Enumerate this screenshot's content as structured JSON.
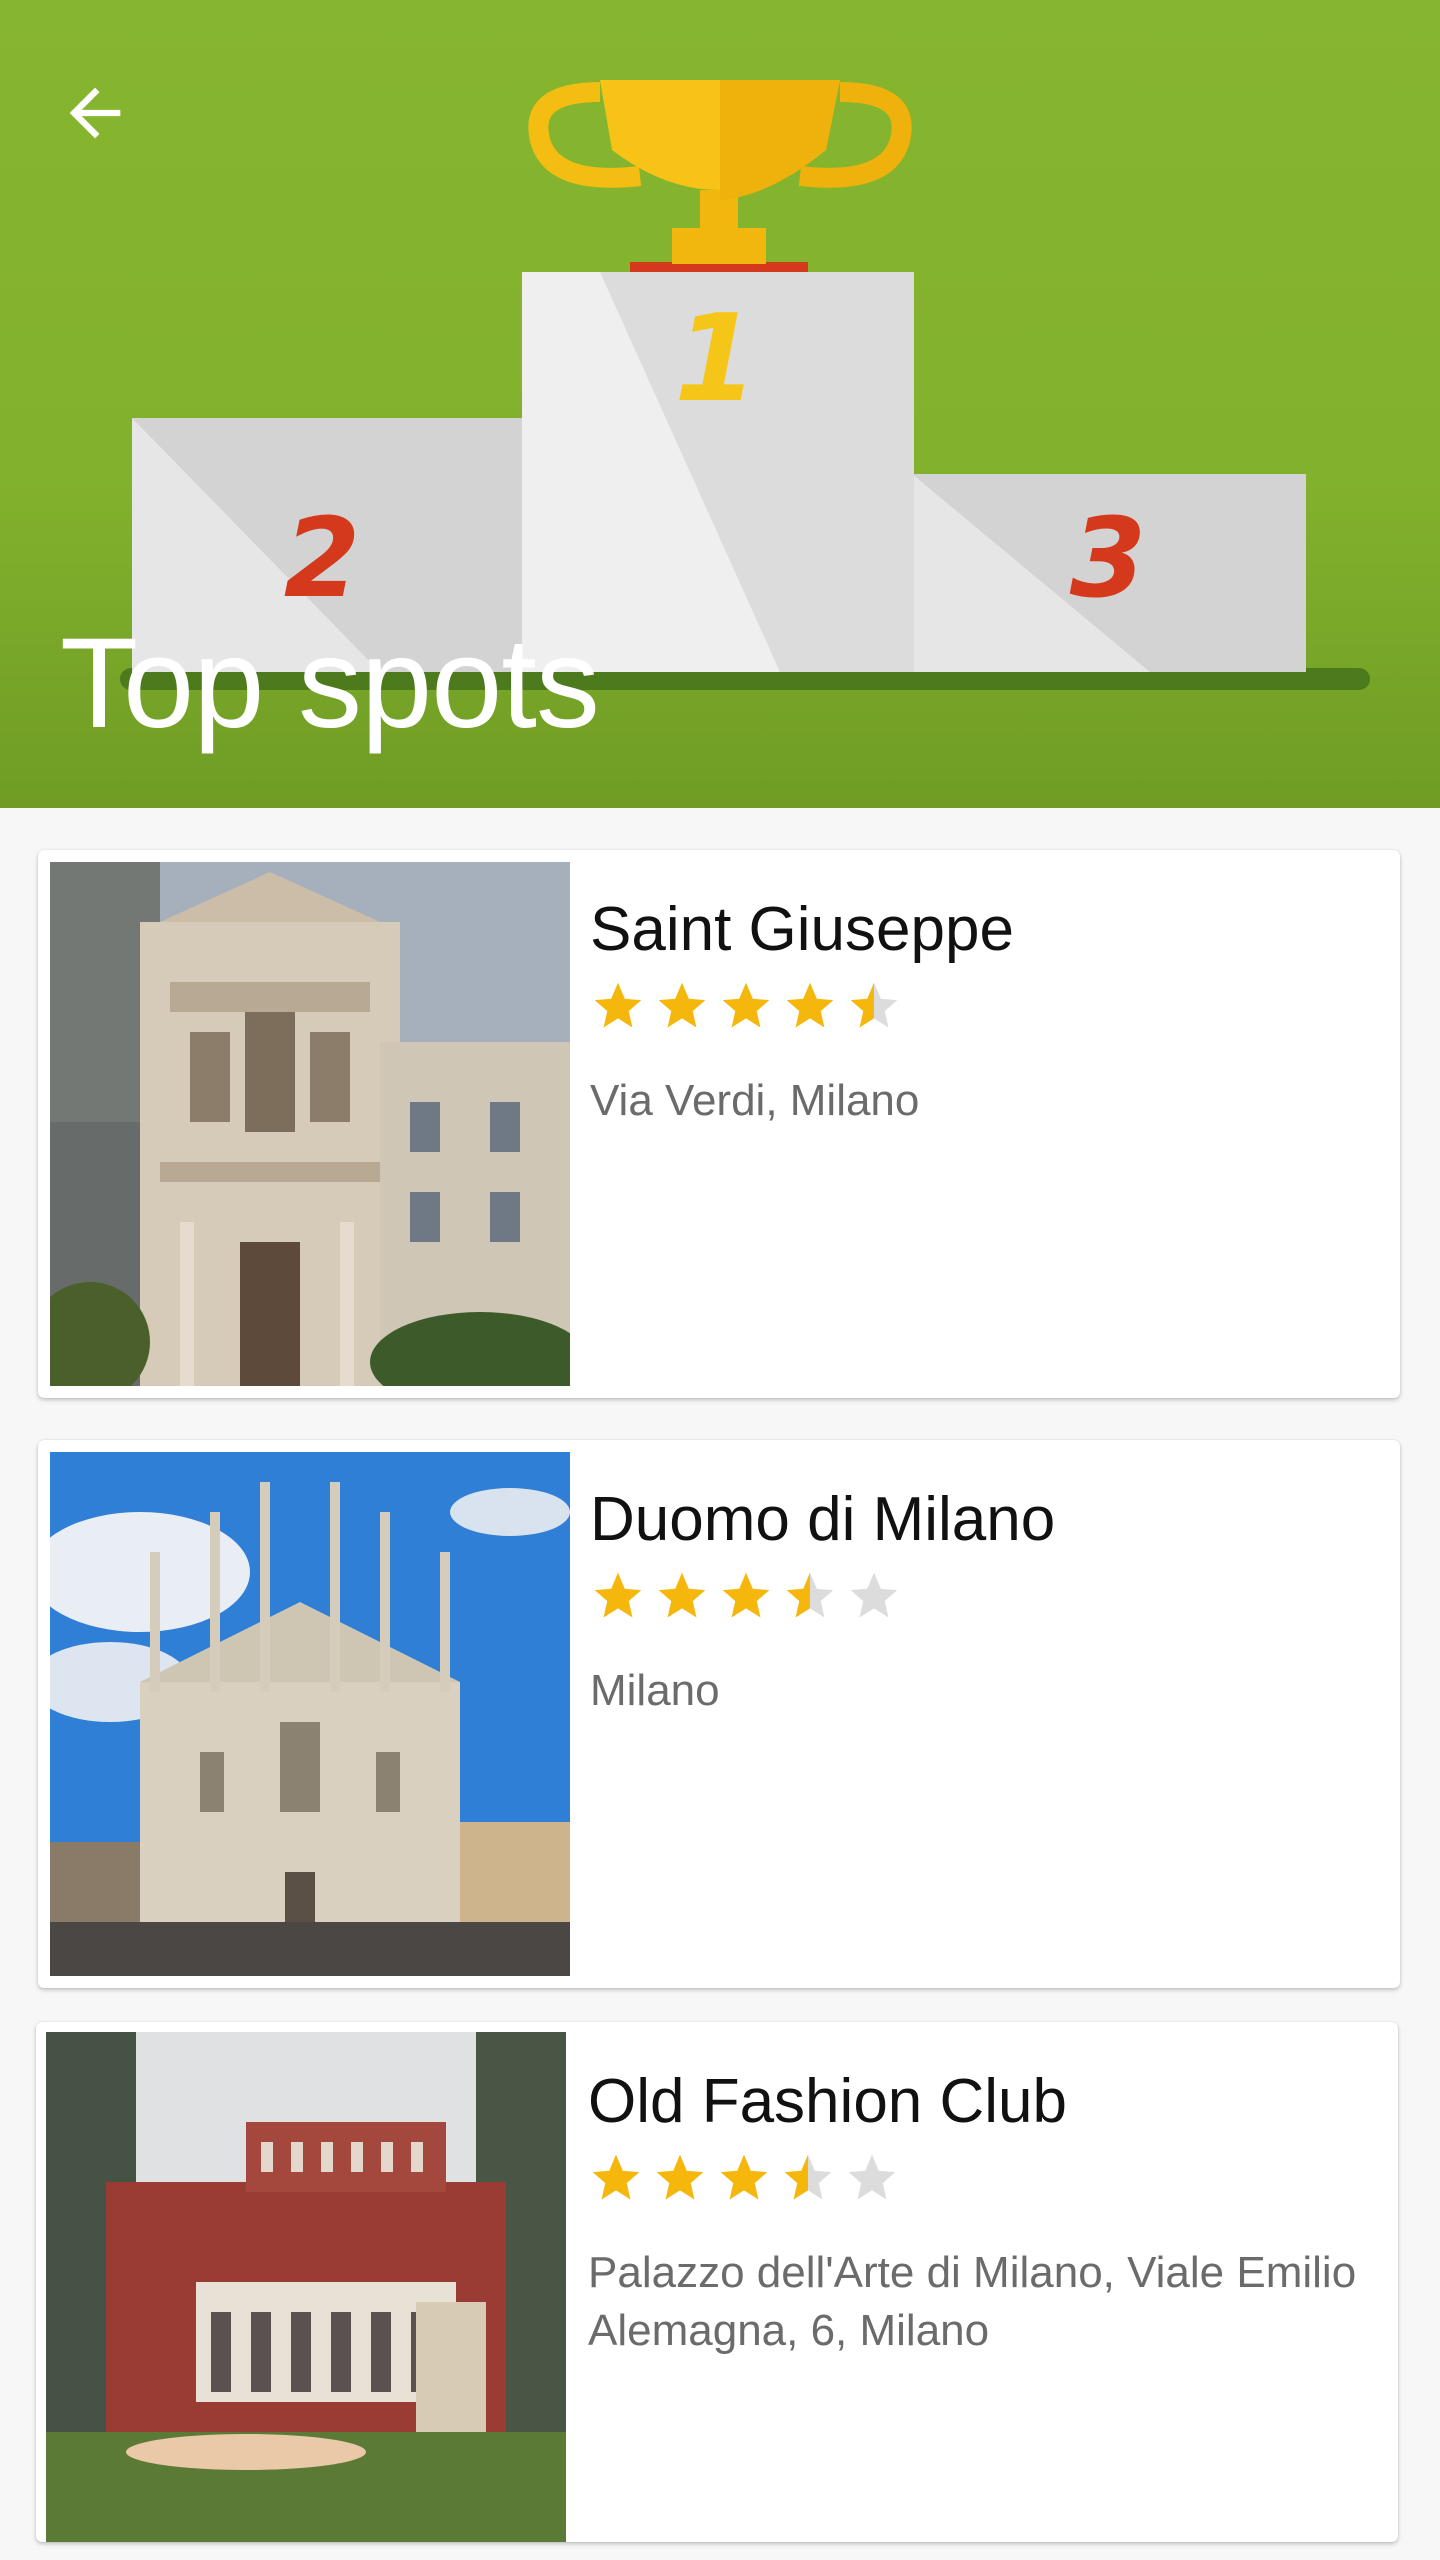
{
  "header": {
    "title": "Top spots",
    "back_icon": "arrow-back-icon",
    "colors": {
      "background": "#82b12d",
      "title": "#ffffff"
    }
  },
  "spots": [
    {
      "name": "Saint Giuseppe",
      "rating": 4.5,
      "address": "Via Verdi, Milano"
    },
    {
      "name": "Duomo di Milano",
      "rating": 3.5,
      "address": "Milano"
    },
    {
      "name": "Old Fashion Club",
      "rating": 3.5,
      "address": "Palazzo dell'Arte di Milano, Viale Emilio Alemagna, 6, Milano"
    }
  ],
  "rating_max": 5,
  "colors": {
    "star_filled": "#f6b70c",
    "star_empty": "#dcdcdc"
  }
}
